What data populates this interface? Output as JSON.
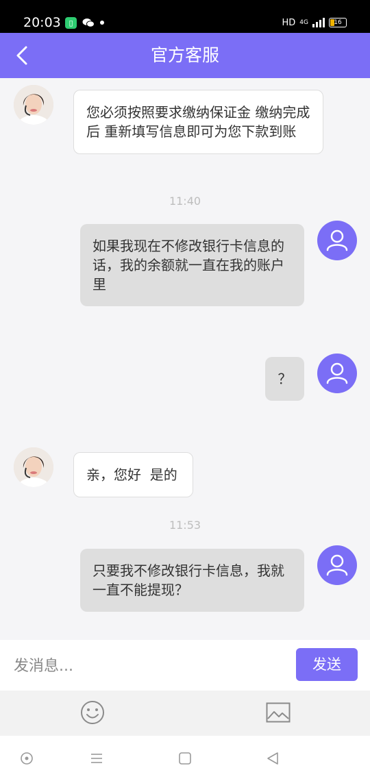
{
  "status_bar": {
    "time": "20:03",
    "network_label": "HD",
    "network_type": "4G",
    "battery_level": "16"
  },
  "header": {
    "title": "官方客服"
  },
  "messages": [
    {
      "from": "support",
      "text": "您必须按照要求缴纳保证金 缴纳完成后 重新填写信息即可为您下款到账"
    },
    {
      "time": "11:40"
    },
    {
      "from": "user",
      "text": "如果我现在不修改银行卡信息的话，我的余额就一直在我的账户里"
    },
    {
      "from": "user",
      "text": "？"
    },
    {
      "from": "support",
      "text": "亲，您好  是的"
    },
    {
      "time": "11:53"
    },
    {
      "from": "user",
      "text": "只要我不修改银行卡信息，我就一直不能提现？"
    }
  ],
  "input": {
    "placeholder": "发消息...",
    "value": ""
  },
  "send_button": "发送",
  "colors": {
    "accent": "#7b6ef6",
    "chat_background": "#f5f5f7",
    "user_bubble": "#dedede",
    "support_bubble": "#ffffff"
  },
  "icons": {
    "back": "chevron-left-icon",
    "emoji": "smiley-icon",
    "image": "image-icon",
    "user_avatar": "person-icon"
  }
}
